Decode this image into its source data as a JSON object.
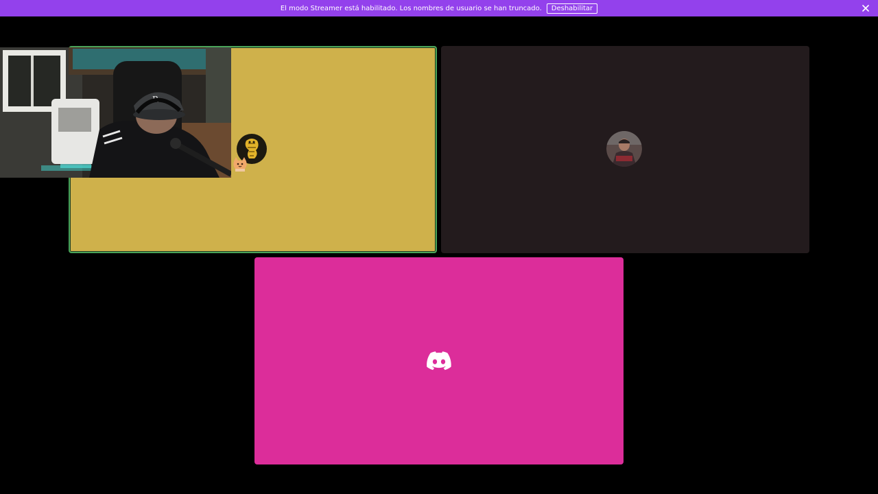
{
  "notice": {
    "message": "El modo Streamer está habilitado. Los nombres de usuario se han truncado.",
    "button_label": "Deshabilitar",
    "close_icon": "close-icon",
    "background_color": "#9341ec"
  },
  "tiles": [
    {
      "id": "user-1",
      "background_color": "#cfb14b",
      "speaking": true,
      "speaking_ring_color": "#4aa459",
      "avatar_icon": "golden-snake-avatar"
    },
    {
      "id": "user-2",
      "background_color": "#231b1d",
      "speaking": false,
      "avatar_icon": "person-photo-avatar"
    },
    {
      "id": "user-3",
      "background_color": "#dc2d9a",
      "speaking": false,
      "avatar_icon": "discord-logo-icon"
    }
  ],
  "camera_preview": {
    "icon": "streamer-webcam-feed"
  }
}
